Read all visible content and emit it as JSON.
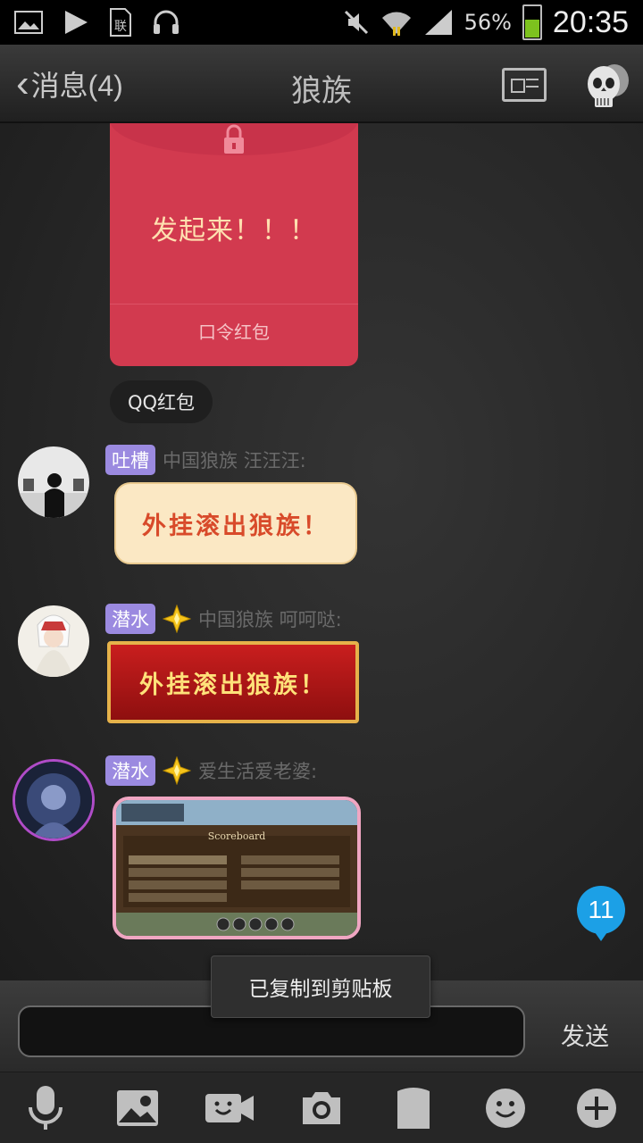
{
  "status_bar": {
    "battery_percent": "56%",
    "time": "20:35",
    "icons": [
      "gallery-icon",
      "play-icon",
      "sim-icon",
      "headset-icon",
      "mute-icon",
      "wifi-icon",
      "signal-icon",
      "battery-icon"
    ]
  },
  "header": {
    "back_label": "消息(4)",
    "title": "狼族"
  },
  "messages": {
    "red_envelope": {
      "message": "发起来！！！",
      "type_label": "口令红包",
      "source_tag": "QQ红包"
    },
    "msg1": {
      "badge": "吐槽",
      "sender": "中国狼族 汪汪汪:",
      "sticker_text": "外挂滚出狼族！"
    },
    "msg2": {
      "badge": "潜水",
      "sender": "中国狼族  呵呵哒:",
      "sticker_text": "外挂滚出狼族！"
    },
    "msg3": {
      "badge": "潜水",
      "sender": "爱生活爱老婆:",
      "image_title": "Scoreboard"
    }
  },
  "unread_count": "11",
  "toast": "已复制到剪贴板",
  "input": {
    "value": "",
    "send_label": "发送"
  },
  "toolbar": {
    "icons": [
      "microphone-icon",
      "photo-icon",
      "video-icon",
      "camera-icon",
      "file-icon",
      "emoji-icon",
      "plus-icon"
    ]
  },
  "colors": {
    "accent": "#1ca0e6",
    "badge": "#9b8ae0",
    "red_envelope": "#d23a4f"
  }
}
